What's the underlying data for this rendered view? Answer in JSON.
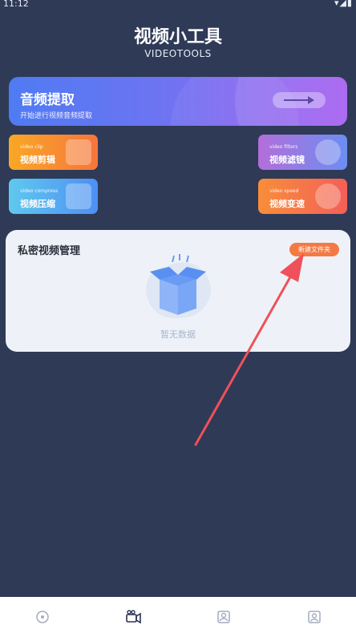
{
  "status": {
    "time": "11:12",
    "icons": "▾◢▮"
  },
  "header": {
    "title": "视频小工具",
    "subtitle": "VIDEOTOOLS"
  },
  "banner": {
    "title": "音频提取",
    "subtitle": "开始进行视频音频提取"
  },
  "tools": [
    {
      "en": "video clip",
      "cn": "视频剪辑"
    },
    {
      "en": "video filters",
      "cn": "视频滤镜"
    },
    {
      "en": "video compress",
      "cn": "视频压缩"
    },
    {
      "en": "video speed",
      "cn": "视频变速"
    }
  ],
  "card": {
    "title": "私密视频管理",
    "button": "新建文件夹",
    "empty": "暂无数据"
  },
  "bottom_nav": [
    {
      "icon": "disc-icon"
    },
    {
      "icon": "camera-icon"
    },
    {
      "icon": "portrait-icon"
    },
    {
      "icon": "user-icon"
    }
  ],
  "colors": {
    "background": "#2f3a57",
    "accent_orange": "#f47a45",
    "annotation_arrow": "#f0505a"
  }
}
